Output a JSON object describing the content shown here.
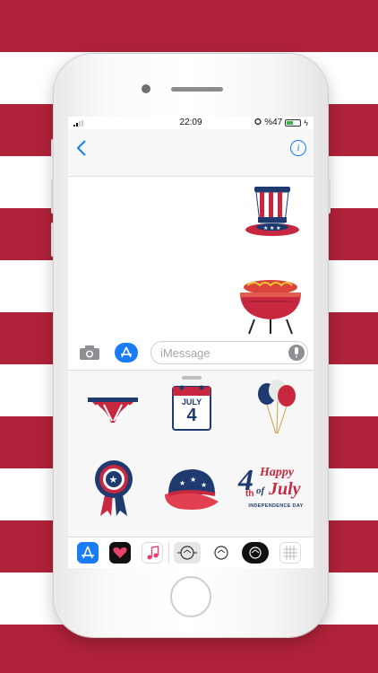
{
  "status_bar": {
    "time": "22:09",
    "battery": "%47"
  },
  "compose": {
    "placeholder": "iMessage"
  },
  "stickers": {
    "calendar_month": "JULY",
    "calendar_day": "4",
    "happy_line1": "Happy",
    "happy_4": "4",
    "happy_th": "th",
    "happy_of": "of",
    "happy_july": "July",
    "happy_subtitle": "INDEPENDENCE DAY"
  },
  "colors": {
    "stripe_red": "#b0223a",
    "accent_blue": "#1a7cf5",
    "flag_navy": "#1e3a6e"
  }
}
